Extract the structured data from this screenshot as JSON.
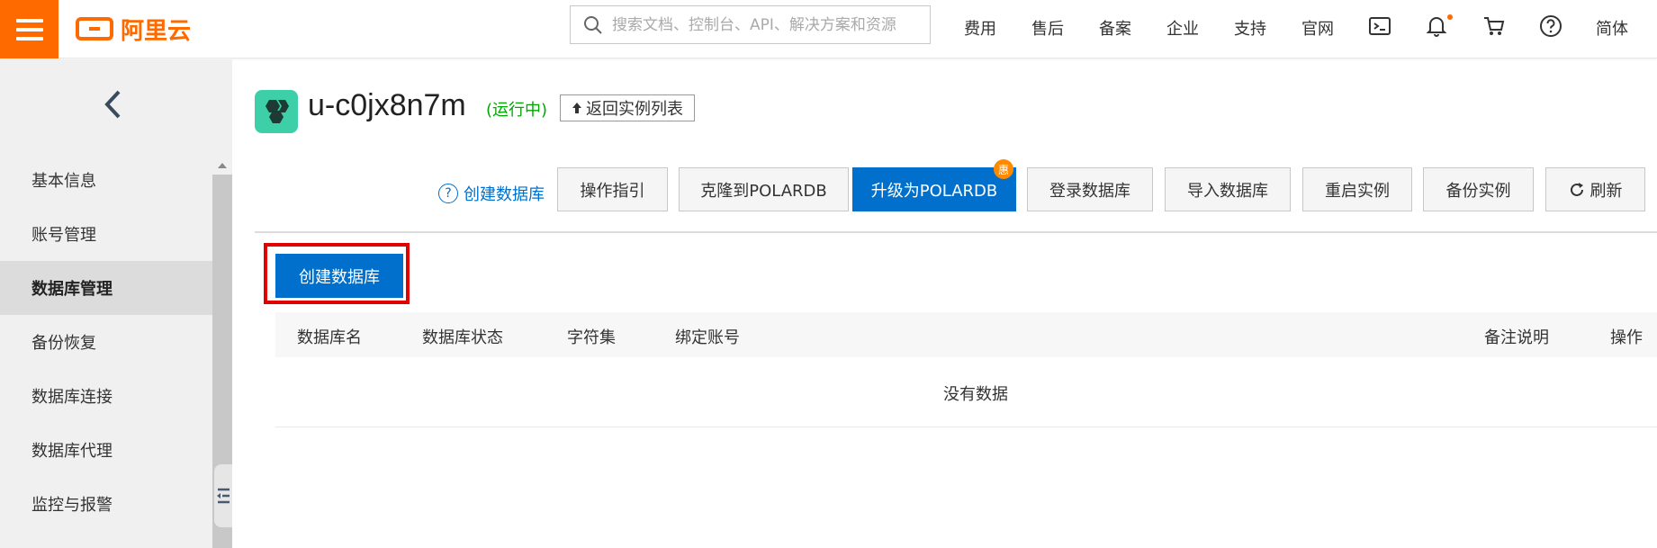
{
  "brand": {
    "logo_text": "阿里云",
    "accent": "#ff6a00"
  },
  "search": {
    "placeholder": "搜索文档、控制台、API、解决方案和资源"
  },
  "nav": [
    "费用",
    "售后",
    "备案",
    "企业",
    "支持",
    "官网"
  ],
  "nav_lang": "简体",
  "nav_icons": [
    "terminal-icon",
    "bell-icon",
    "cart-icon",
    "help-icon"
  ],
  "sidebar": {
    "items": [
      {
        "label": "基本信息"
      },
      {
        "label": "账号管理"
      },
      {
        "label": "数据库管理",
        "active": true
      },
      {
        "label": "备份恢复"
      },
      {
        "label": "数据库连接"
      },
      {
        "label": "数据库代理"
      },
      {
        "label": "监控与报警"
      }
    ]
  },
  "instance": {
    "name": "u-c0jx8n7m",
    "status": "(运行中)",
    "back_label": "返回实例列表"
  },
  "toolbar": {
    "help_link": "创建数据库",
    "buttons": [
      {
        "label": "操作指引"
      },
      {
        "label": "克隆到POLARDB"
      },
      {
        "label": "升级为POLARDB",
        "primary": true,
        "badge": "惠"
      },
      {
        "label": "登录数据库"
      },
      {
        "label": "导入数据库"
      },
      {
        "label": "重启实例"
      },
      {
        "label": "备份实例"
      },
      {
        "label": "刷新"
      }
    ]
  },
  "main": {
    "create_button": "创建数据库",
    "table": {
      "columns": [
        "数据库名",
        "数据库状态",
        "字符集",
        "绑定账号",
        "备注说明",
        "操作"
      ],
      "empty_text": "没有数据"
    }
  },
  "colors": {
    "primary": "#0070cc",
    "highlight": "#e00000",
    "status": "#00a700"
  }
}
